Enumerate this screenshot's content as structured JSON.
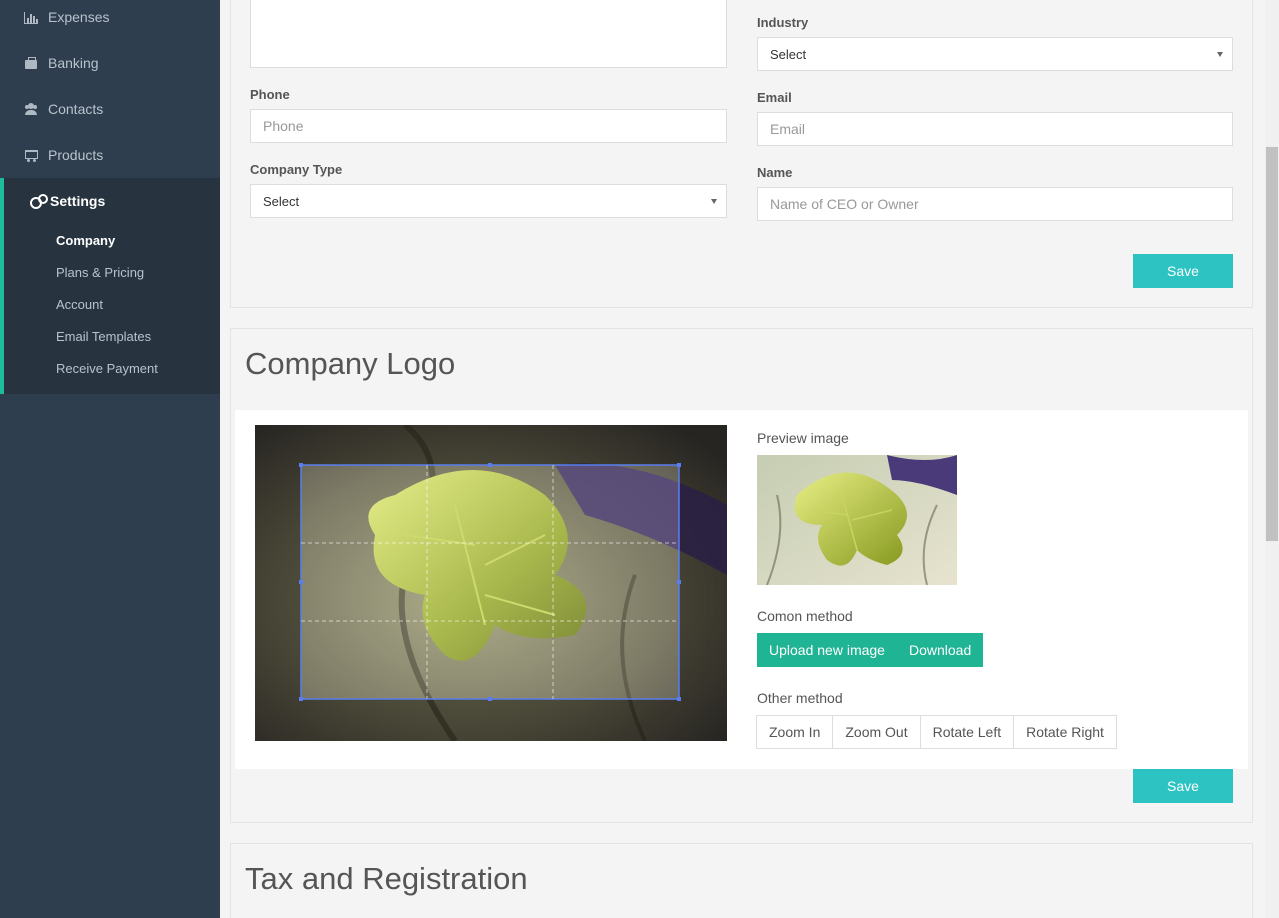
{
  "sidebar": {
    "items": [
      {
        "label": "Expenses",
        "icon": "bar-chart-icon"
      },
      {
        "label": "Banking",
        "icon": "briefcase-icon"
      },
      {
        "label": "Contacts",
        "icon": "users-icon"
      },
      {
        "label": "Products",
        "icon": "cart-icon"
      },
      {
        "label": "Settings",
        "icon": "cogs-icon"
      }
    ],
    "settings_sub": [
      "Company",
      "Plans & Pricing",
      "Account",
      "Email Templates",
      "Receive Payment"
    ],
    "active_sub": "Company",
    "accent_color": "#1ebc9c"
  },
  "company_form": {
    "industry_label": "Industry",
    "industry_value": "Select",
    "phone_label": "Phone",
    "phone_placeholder": "Phone",
    "email_label": "Email",
    "email_placeholder": "Email",
    "company_type_label": "Company Type",
    "company_type_value": "Select",
    "name_label": "Name",
    "name_placeholder": "Name of CEO or Owner",
    "save_label": "Save"
  },
  "logo_section": {
    "title": "Company Logo",
    "preview_label": "Preview image",
    "common_method_label": "Comon method",
    "upload_label": "Upload new image",
    "download_label": "Download",
    "other_method_label": "Other method",
    "zoom_in_label": "Zoom In",
    "zoom_out_label": "Zoom Out",
    "rotate_left_label": "Rotate Left",
    "rotate_right_label": "Rotate Right",
    "save_label": "Save"
  },
  "tax_section": {
    "title": "Tax and Registration"
  },
  "colors": {
    "save_button": "#2dc3c3",
    "upload_button": "#1fb493",
    "sidebar_bg": "#2e3e4e"
  }
}
